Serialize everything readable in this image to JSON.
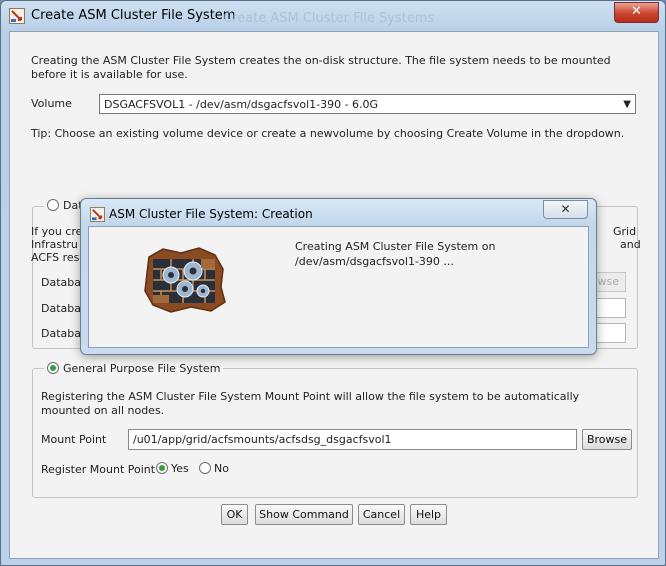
{
  "window": {
    "title": "Create ASM Cluster File System",
    "ghost_title": "Create ASM Cluster File Systems",
    "close_label": "✕"
  },
  "intro_text": "Creating the ASM Cluster File System creates the on-disk structure. The file system needs to be mounted before it is available for use.",
  "volume": {
    "label": "Volume",
    "selected": "DSGACFSVOL1 - /dev/asm/dsgacfsvol1-390 - 6.0G"
  },
  "tip": "Tip: Choose an existing volume device or create a newvolume by choosing Create Volume in the dropdown.",
  "db_group": {
    "radio_label": "Dat",
    "desc_line1": "If you cre",
    "desc_line2": "Infrastru",
    "desc_line3": "ACFS res",
    "desc_right1": "Grid",
    "desc_right2": "and",
    "field_labels": [
      "Databas",
      "Databas",
      "Databas"
    ],
    "browse_label": "wse",
    "selected": false
  },
  "gp_group": {
    "radio_label": "General Purpose File System",
    "selected": true,
    "desc": "Registering the ASM Cluster File System Mount Point will allow the file system to be automatically mounted on all nodes.",
    "mount_point_label": "Mount Point",
    "mount_point_value": "/u01/app/grid/acfsmounts/acfsdsg_dsgacfsvol1",
    "browse_label": "Browse",
    "register_label": "Register Mount Point",
    "yes_label": "Yes",
    "no_label": "No",
    "register_value": "Yes"
  },
  "buttons": {
    "ok": "OK",
    "show_command": "Show Command",
    "cancel": "Cancel",
    "help": "Help"
  },
  "modal": {
    "title": "ASM Cluster File System: Creation",
    "close_label": "✕",
    "message_line1": "Creating ASM Cluster File System on",
    "message_line2": "/dev/asm/dsgacfsvol1-390 ..."
  },
  "colors": {
    "radio_selected": "#3c9a3c",
    "title_bar": "#bcd2ea",
    "close_button": "#c9452e"
  }
}
